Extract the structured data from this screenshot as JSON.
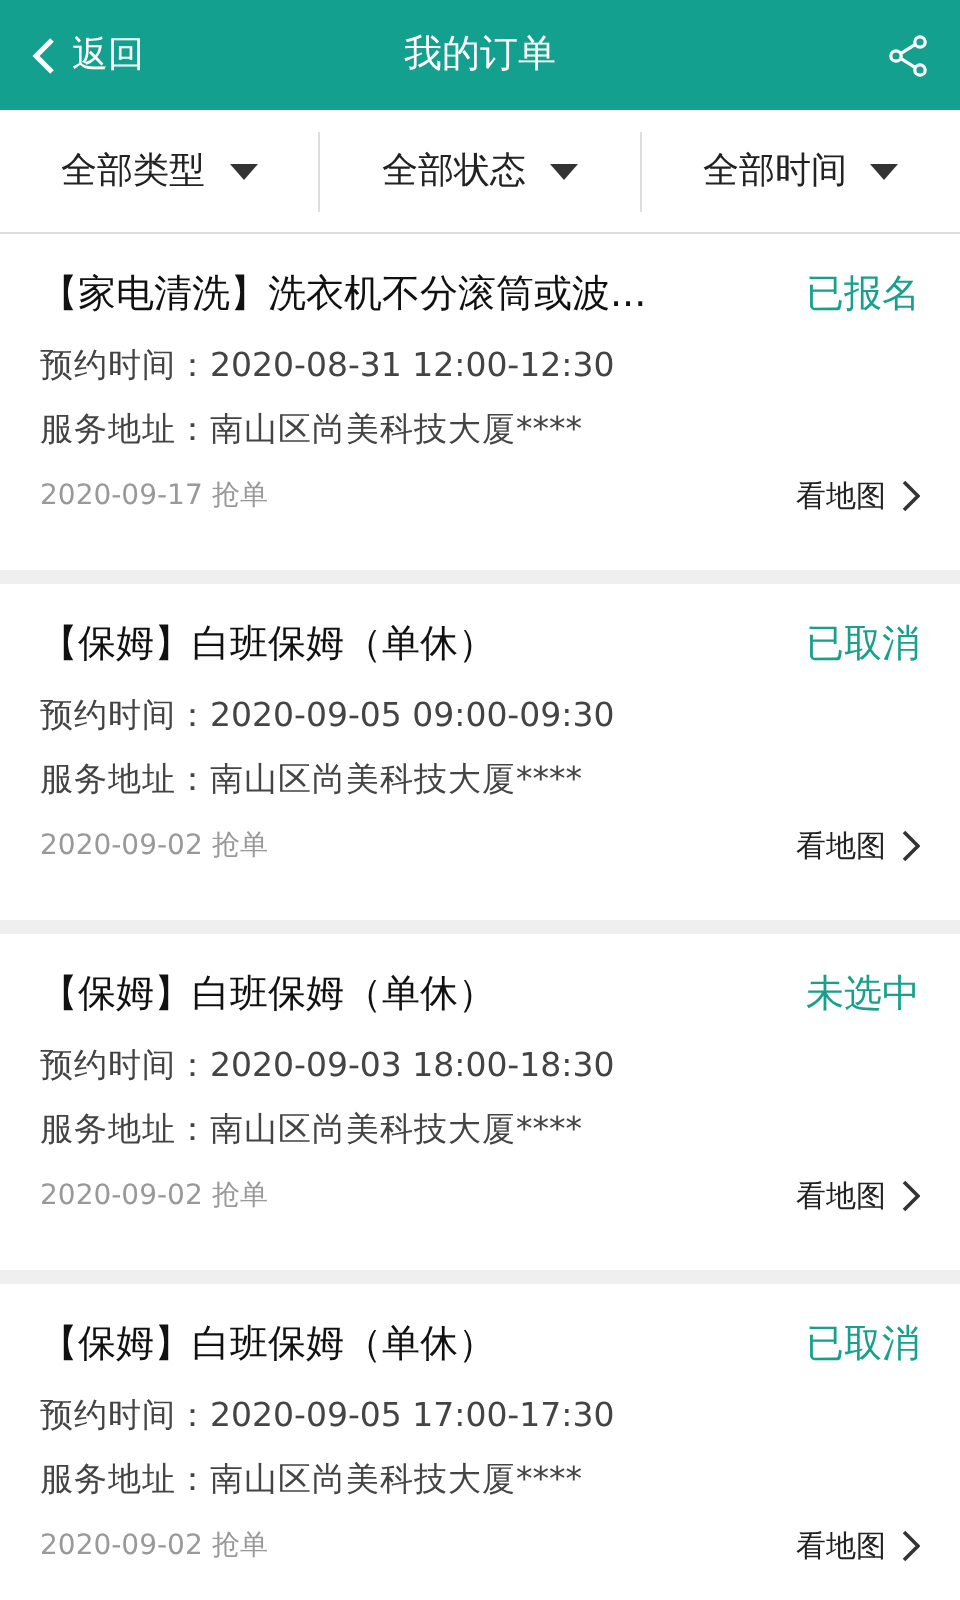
{
  "header": {
    "back_label": "返回",
    "title": "我的订单"
  },
  "filters": [
    {
      "label": "全部类型"
    },
    {
      "label": "全部状态"
    },
    {
      "label": "全部时间"
    }
  ],
  "orders": [
    {
      "title": "【家电清洗】洗衣机不分滚筒或波...",
      "status": "已报名",
      "appointment": "预约时间：2020-08-31 12:00-12:30",
      "address": "服务地址：南山区尚美科技大厦****",
      "date": "2020-09-17 抢单",
      "map_link": "看地图"
    },
    {
      "title": "【保姆】白班保姆（单休）",
      "status": "已取消",
      "appointment": "预约时间：2020-09-05 09:00-09:30",
      "address": "服务地址：南山区尚美科技大厦****",
      "date": "2020-09-02 抢单",
      "map_link": "看地图"
    },
    {
      "title": "【保姆】白班保姆（单休）",
      "status": "未选中",
      "appointment": "预约时间：2020-09-03 18:00-18:30",
      "address": "服务地址：南山区尚美科技大厦****",
      "date": "2020-09-02 抢单",
      "map_link": "看地图"
    },
    {
      "title": "【保姆】白班保姆（单休）",
      "status": "已取消",
      "appointment": "预约时间：2020-09-05 17:00-17:30",
      "address": "服务地址：南山区尚美科技大厦****",
      "date": "2020-09-02 抢单",
      "map_link": "看地图"
    }
  ]
}
